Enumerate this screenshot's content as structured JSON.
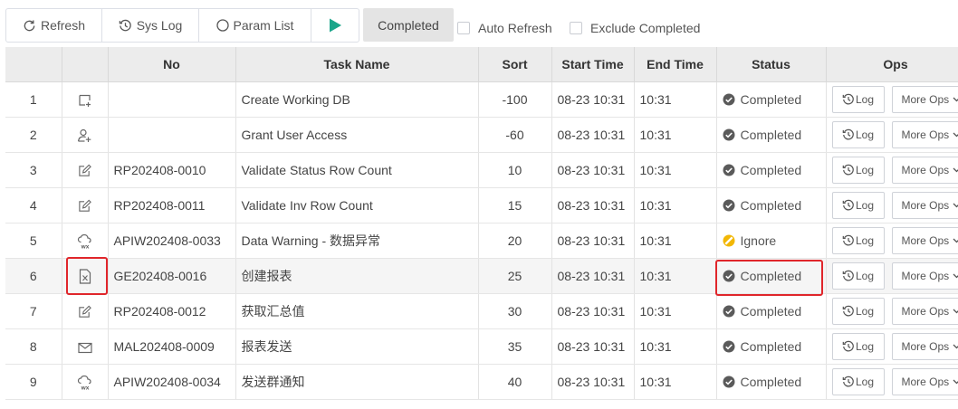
{
  "toolbar": {
    "refresh_label": "Refresh",
    "syslog_label": "Sys Log",
    "paramlist_label": "Param List",
    "status_filter": "Completed",
    "auto_refresh_label": "Auto Refresh",
    "exclude_completed_label": "Exclude Completed",
    "run_icon_color": "#1aa58a"
  },
  "table": {
    "columns": [
      "",
      "",
      "No",
      "Task Name",
      "Sort",
      "Start Time",
      "End Time",
      "Status",
      "Ops"
    ],
    "log_label": "Log",
    "more_ops_label": "More Ops",
    "rows": [
      {
        "idx": "1",
        "icon": "database-add-icon",
        "no": "",
        "task": "Create Working DB",
        "sort": "-100",
        "start": "08-23 10:31",
        "end": "10:31",
        "status": "Completed",
        "status_icon": "check-circle-icon"
      },
      {
        "idx": "2",
        "icon": "user-add-icon",
        "no": "",
        "task": "Grant User Access",
        "sort": "-60",
        "start": "08-23 10:31",
        "end": "10:31",
        "status": "Completed",
        "status_icon": "check-circle-icon"
      },
      {
        "idx": "3",
        "icon": "edit-icon",
        "no": "RP202408-0010",
        "task": "Validate Status Row Count",
        "sort": "10",
        "start": "08-23 10:31",
        "end": "10:31",
        "status": "Completed",
        "status_icon": "check-circle-icon"
      },
      {
        "idx": "4",
        "icon": "edit-icon",
        "no": "RP202408-0011",
        "task": "Validate Inv Row Count",
        "sort": "15",
        "start": "08-23 10:31",
        "end": "10:31",
        "status": "Completed",
        "status_icon": "check-circle-icon"
      },
      {
        "idx": "5",
        "icon": "wx-cloud-icon",
        "no": "APIW202408-0033",
        "task": "Data Warning - 数据异常",
        "sort": "20",
        "start": "08-23 10:31",
        "end": "10:31",
        "status": "Ignore",
        "status_icon": "ignore-icon"
      },
      {
        "idx": "6",
        "icon": "excel-file-icon",
        "no": "GE202408-0016",
        "task": "创建报表",
        "sort": "25",
        "start": "08-23 10:31",
        "end": "10:31",
        "status": "Completed",
        "status_icon": "check-circle-icon"
      },
      {
        "idx": "7",
        "icon": "edit-icon",
        "no": "RP202408-0012",
        "task": "获取汇总值",
        "sort": "30",
        "start": "08-23 10:31",
        "end": "10:31",
        "status": "Completed",
        "status_icon": "check-circle-icon"
      },
      {
        "idx": "8",
        "icon": "mail-icon",
        "no": "MAL202408-0009",
        "task": "报表发送",
        "sort": "35",
        "start": "08-23 10:31",
        "end": "10:31",
        "status": "Completed",
        "status_icon": "check-circle-icon"
      },
      {
        "idx": "9",
        "icon": "wx-cloud-icon",
        "no": "APIW202408-0034",
        "task": "发送群通知",
        "sort": "40",
        "start": "08-23 10:31",
        "end": "10:31",
        "status": "Completed",
        "status_icon": "check-circle-icon"
      }
    ]
  },
  "colors": {
    "check": "#5a5a5a",
    "ignore": "#f2b705",
    "highlight": "#e0262b"
  }
}
